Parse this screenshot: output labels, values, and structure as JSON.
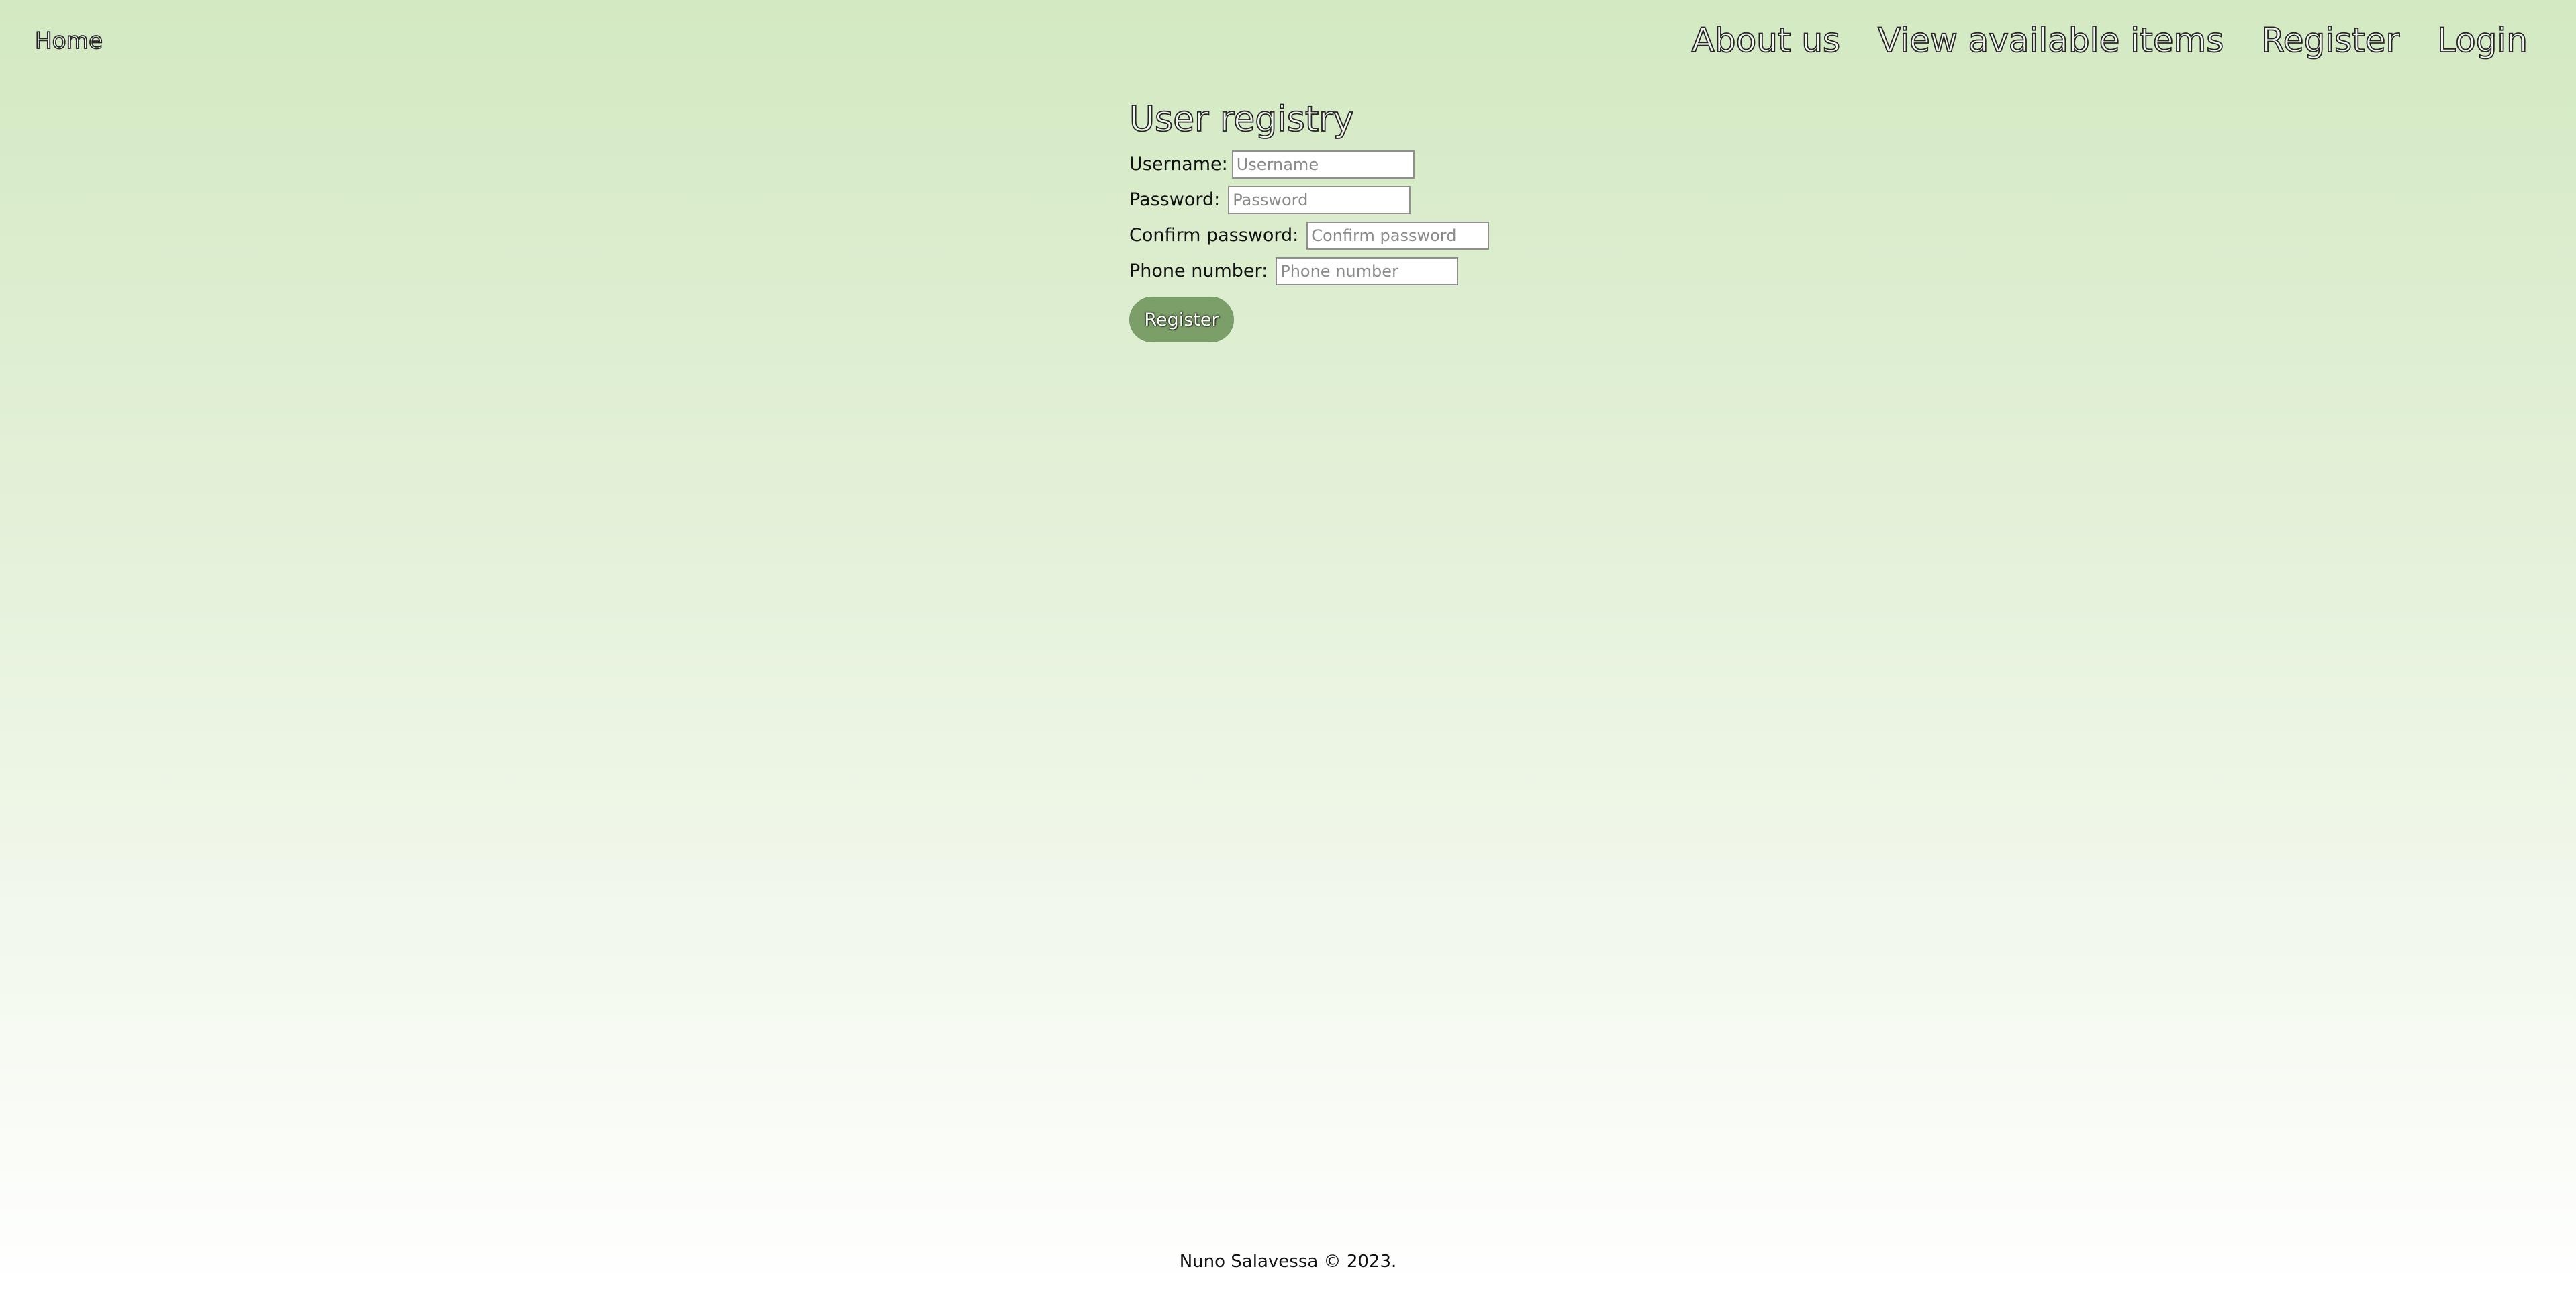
{
  "nav": {
    "home": "Home",
    "links": [
      "About us",
      "View available items",
      "Register",
      "Login"
    ]
  },
  "form": {
    "title": "User registry",
    "username_label": "Username:",
    "username_placeholder": "Username",
    "password_label": "Password:",
    "password_placeholder": "Password",
    "confirm_label": "Confirm password:",
    "confirm_placeholder": "Confirm password",
    "phone_label": "Phone number:",
    "phone_placeholder": "Phone number",
    "submit_label": "Register"
  },
  "footer": {
    "text": "Nuno Salavessa © 2023."
  },
  "colors": {
    "bg_top": "#d3e9c2",
    "bg_bottom": "#ffffff",
    "button": "#7c9f69"
  }
}
